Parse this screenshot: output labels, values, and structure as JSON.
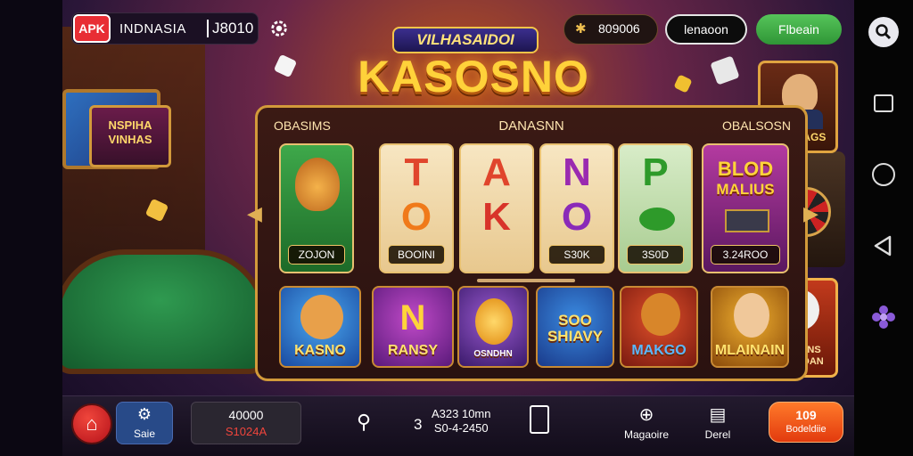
{
  "topbar": {
    "apk_badge": "APK",
    "region": "INDNASIA",
    "balance": "J8010",
    "coins": "809006",
    "login": "lenaoon",
    "register": "Flbeain"
  },
  "logo": {
    "subtitle": "VILHASAIDOI",
    "title": "KASOSNO"
  },
  "panel": {
    "left_title": "OBASIMS",
    "center_title": "DANASNN",
    "right_title": "OBALSOSN",
    "reels": [
      {
        "symbol_top": "",
        "symbol_bottom": "",
        "value": "ZOJON",
        "color": "#2f9a3c"
      },
      {
        "symbol_top": "T",
        "symbol_bottom": "O",
        "value": "BOOINI",
        "color": "#f3dcae"
      },
      {
        "symbol_top": "A",
        "symbol_bottom": "K",
        "value": "",
        "color": "#f3dcae"
      },
      {
        "symbol_top": "N",
        "symbol_bottom": "O",
        "value": "S30K",
        "color": "#f3dcae"
      },
      {
        "symbol_top": "P",
        "symbol_bottom": "",
        "value": "3S0D",
        "color": "#cde6c0"
      },
      {
        "symbol_top": "BLOD",
        "symbol_bottom": "MALIUS",
        "value": "3.24ROO",
        "color": "#8a2a8a"
      }
    ],
    "tiles": [
      {
        "caption": "KASNO",
        "color": "#2f8ad6"
      },
      {
        "caption": "RANSY",
        "color": "#8a2a9a"
      },
      {
        "caption": "OSNDHN",
        "color": "#6a3aa8"
      },
      {
        "caption": "SOO SHIAVY",
        "color": "#2a6ab8"
      },
      {
        "caption": "MAKGO",
        "color": "#b8321c"
      },
      {
        "caption": "MLAINAIN",
        "color": "#d08a1a"
      }
    ]
  },
  "decor": {
    "sign_left": "NSPIHA VINHAS",
    "promo_top_caption": "WABNAGS",
    "promo_bottom_caption": "CAHIMNS TPHIROAN"
  },
  "bottombar": {
    "save_label": "Saie",
    "wallet_top": "40000",
    "wallet_bottom": "S1024A",
    "stat_num": "3",
    "stat_line1": "A323 10mn",
    "stat_line2": "S0-4-2450",
    "magazine_label": "Magaoire",
    "deal_label": "Derel",
    "promo_top": "109",
    "promo_bottom": "Bodeldiie"
  }
}
